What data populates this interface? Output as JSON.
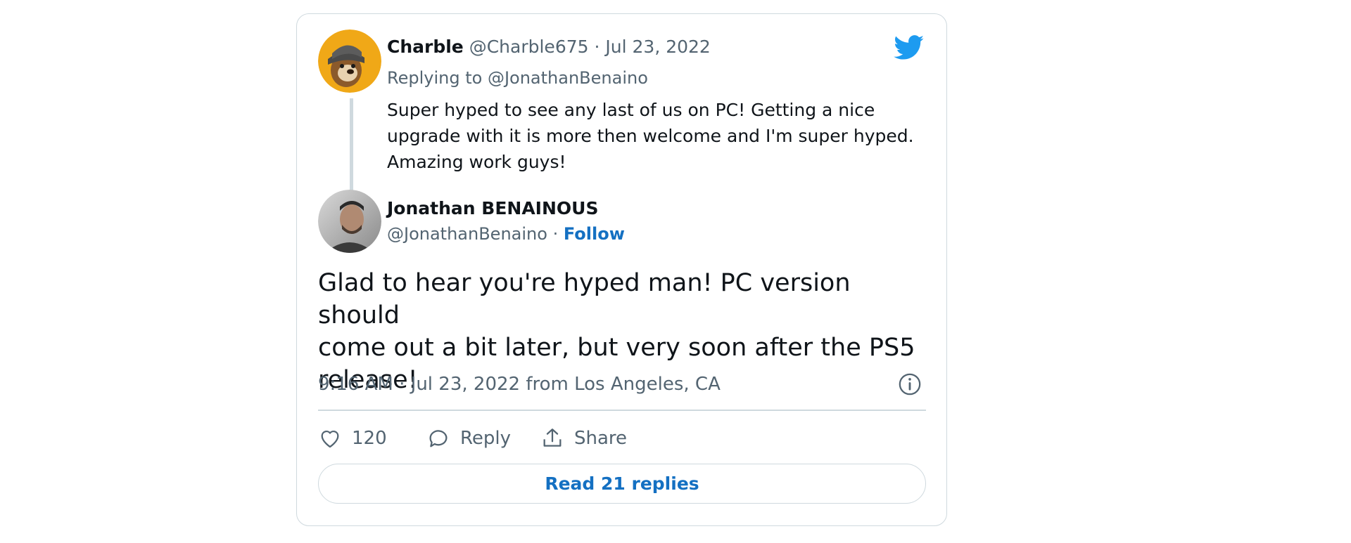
{
  "reply_tweet": {
    "author_name": "Charble",
    "handle": "@Charble675",
    "separator": "·",
    "date": "Jul 23, 2022",
    "replying_prefix": "Replying to",
    "replying_to": "@JonathanBenaino",
    "text_lines": [
      "Super hyped to see any last of us on PC! Getting a nice",
      "upgrade with it is more then welcome and I'm super hyped.",
      "Amazing work guys!"
    ]
  },
  "main_tweet": {
    "author_name": "Jonathan BENAINOUS",
    "handle": "@JonathanBenaino",
    "separator": "·",
    "follow_label": "Follow",
    "text_lines": [
      "Glad to hear you're hyped man! PC version should",
      "come out a bit later, but very soon after the PS5",
      "release!"
    ],
    "timestamp": "9:16 AM · Jul 23, 2022 from Los Angeles, CA"
  },
  "actions": {
    "like_count": "120",
    "reply_label": "Reply",
    "share_label": "Share"
  },
  "read_replies_label": "Read 21 replies",
  "colors": {
    "twitter_blue": "#1d9bf0",
    "link_blue": "#1470c2",
    "muted_text": "#536471",
    "border": "#cfd9de"
  },
  "icons": [
    "twitter-bird-icon",
    "info-icon",
    "heart-icon",
    "reply-bubble-icon",
    "share-icon"
  ]
}
